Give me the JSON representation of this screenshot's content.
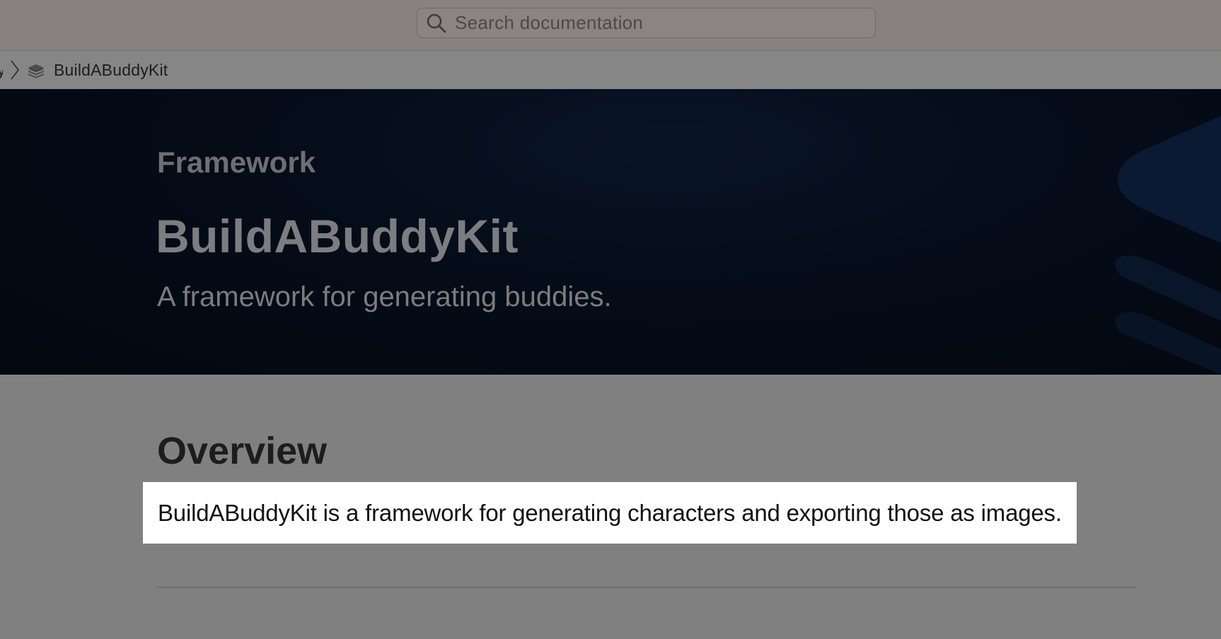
{
  "search": {
    "placeholder": "Search documentation"
  },
  "breadcrumb": {
    "truncated_prev": "y",
    "current": "BuildABuddyKit"
  },
  "hero": {
    "kicker": "Framework",
    "title": "BuildABuddyKit",
    "abstract": "A framework for generating buddies."
  },
  "overview": {
    "heading": "Overview",
    "text": "BuildABuddyKit is a framework for generating characters and exporting those as images."
  },
  "colors": {
    "hero_background": "#050c18",
    "highlight": "#ffffff",
    "dim_overlay": "#808080"
  },
  "icons": {
    "search": "magnifier-icon",
    "breadcrumb_separator": "chevron-right-icon",
    "framework": "stacked-layers-icon",
    "hero_art": "stacked-layers-icon"
  }
}
